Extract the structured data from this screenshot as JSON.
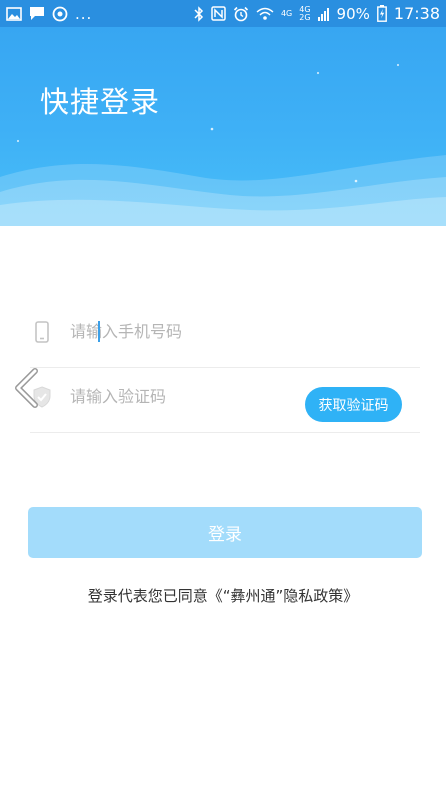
{
  "status_bar": {
    "ellipsis": "...",
    "net_top": "4G",
    "net_bottom": "2G",
    "net_label": "4G",
    "battery": "90%",
    "time": "17:38"
  },
  "header": {
    "title": "快捷登录",
    "colors": {
      "top": "#37a6f2",
      "bottom": "#49bff8"
    }
  },
  "form": {
    "phone_placeholder": "请输入手机号码",
    "phone_value": "",
    "code_placeholder": "请输入验证码",
    "code_value": "",
    "get_code_label": "获取验证码"
  },
  "login_button": {
    "label": "登录"
  },
  "agreement": {
    "prefix": "登录代表您已同意",
    "link": "《“彝州通”隐私政策》"
  },
  "icons": [
    "gallery-icon",
    "message-icon",
    "sync-icon",
    "bluetooth-icon",
    "nfc-icon",
    "alarm-icon",
    "wifi-icon",
    "signal-icon",
    "battery-icon",
    "phone-icon",
    "shield-icon",
    "back-chevron-icon"
  ],
  "colors": {
    "accent": "#2fb2f6",
    "login_disabled": "#a3dcfb",
    "status_bar": "#2a8fe0"
  }
}
